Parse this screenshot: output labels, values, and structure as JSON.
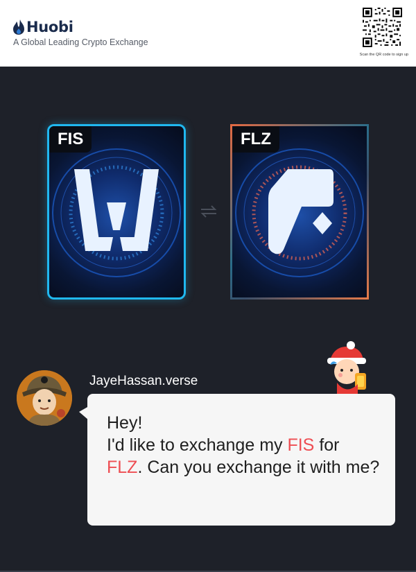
{
  "header": {
    "brand": "Huobi",
    "tagline": "A Global Leading Crypto Exchange",
    "qr_caption": "Scan the QR code to sign up"
  },
  "exchange": {
    "from_token": "FIS",
    "to_token": "FLZ",
    "swap_icon": "swap-arrows-icon"
  },
  "chat": {
    "username": "JayeHassan.verse",
    "message_line1": "Hey!",
    "message_pre_from": "I'd like to exchange my ",
    "message_from": "FIS",
    "message_mid": " for ",
    "message_to": "FLZ",
    "message_post": ". Can you exchange it with me?"
  },
  "colors": {
    "background": "#1e2129",
    "fis_border": "#20b8f0",
    "flz_border": "#e26a42",
    "highlight": "#ee4d52"
  }
}
